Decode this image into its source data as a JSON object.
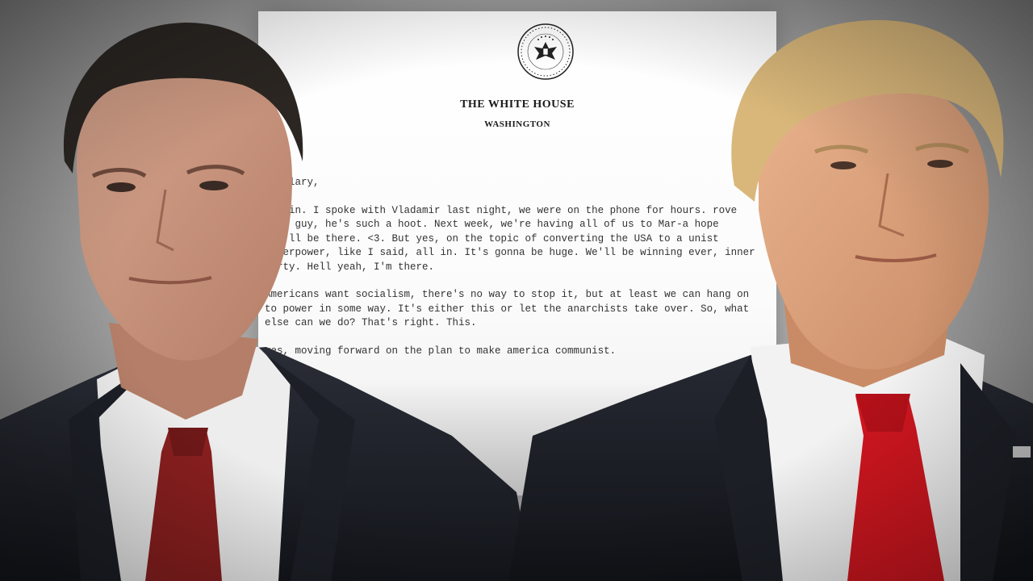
{
  "letter": {
    "letterhead_title": "THE WHITE HOUSE",
    "letterhead_subtitle": "WASHINGTON",
    "paragraphs": [
      "t Hilary,",
      "all in. I spoke with Vladamir last night, we were on the phone for hours. rove that guy, he's such a hoot. Next week, we're having all of us to Mar-a hope you'll be there. <3. But yes, on the topic of converting the USA to a unist superpower, like I said, all in. It's gonna be huge. We'll be winning ever, inner party. Hell yeah, I'm there.",
      "Americans want socialism, there's no way to stop it, but at least we can hang on to power in some way. It's either this or let the anarchists take over. So, what else can we do? That's right. This.",
      "yes, moving forward on the plan to make america communist."
    ]
  },
  "colors": {
    "background": "#a9a9a9",
    "suit": "#1d2028",
    "shirt": "#f2f2f2",
    "left_tie": "#8a1f1f",
    "right_tie": "#d0161f",
    "left_hair": "#2b2622",
    "right_hair": "#d9b77a"
  },
  "icons": {
    "seal": "presidential-seal-icon"
  }
}
